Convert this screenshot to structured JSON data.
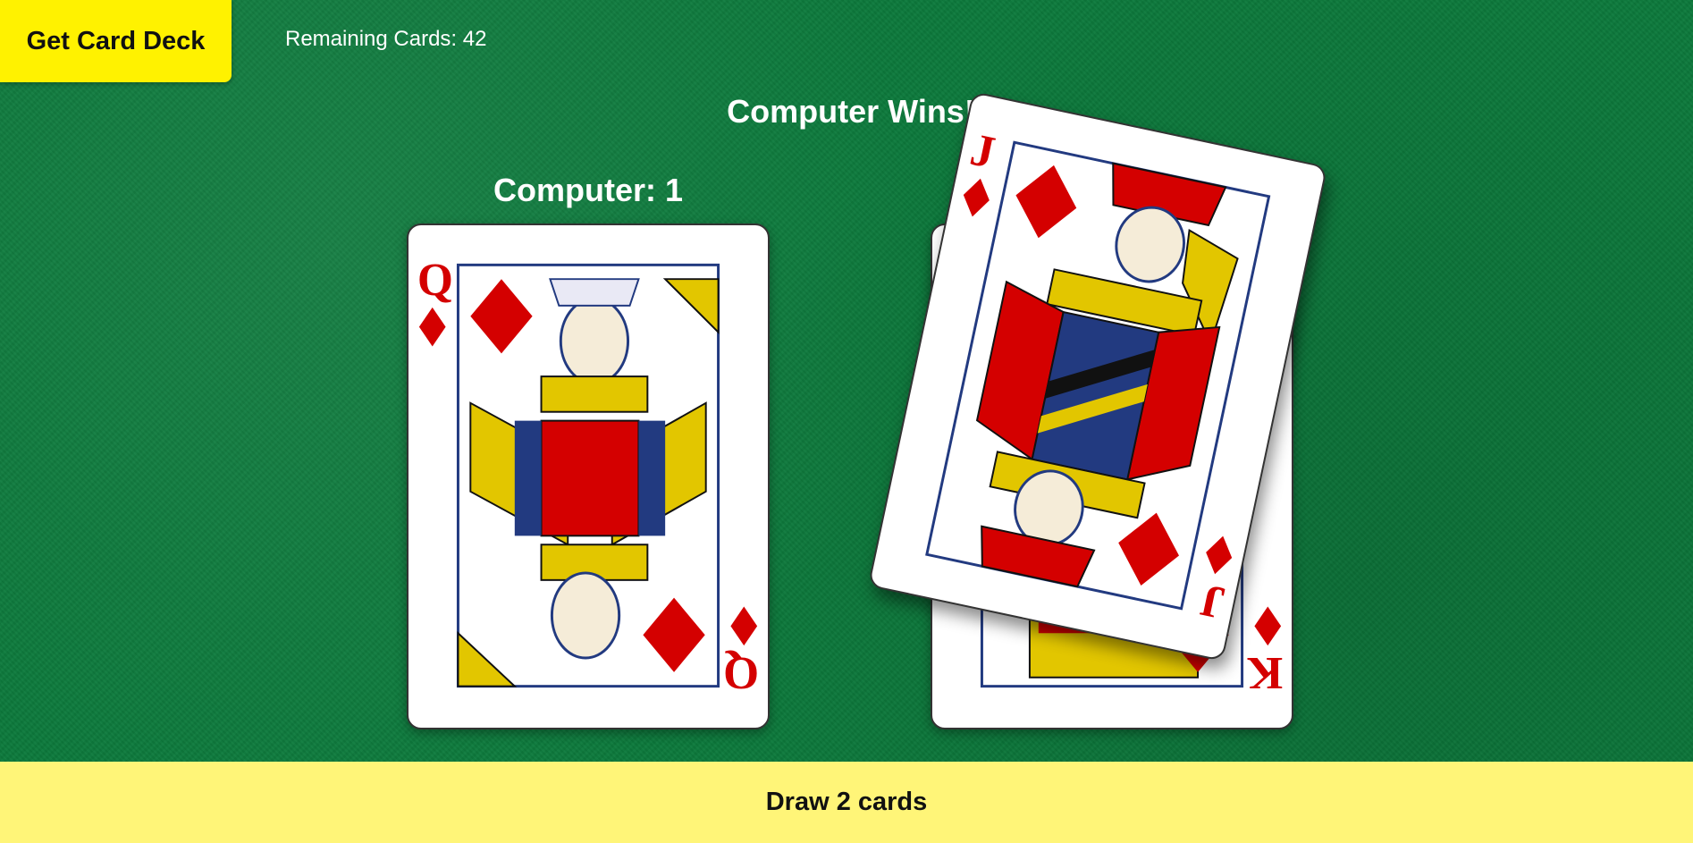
{
  "header": {
    "deck_button_label": "Get Card Deck",
    "remaining_label": "Remaining Cards: 42"
  },
  "game": {
    "result": "Computer Wins!",
    "computer_score": "Computer: 1"
  },
  "cards": [
    {
      "rank": "Q",
      "suit": "diamonds",
      "owner": "computer"
    },
    {
      "rank": "K",
      "suit": "diamonds",
      "owner": "player"
    },
    {
      "rank": "J",
      "suit": "diamonds",
      "owner": "pile-top"
    }
  ],
  "footer": {
    "draw_button_label": "Draw 2 cards"
  },
  "colors": {
    "table_green": "#0c7a3c",
    "deck_button": "#fff200",
    "draw_bar": "#fff578",
    "suit_red": "#d40000"
  }
}
